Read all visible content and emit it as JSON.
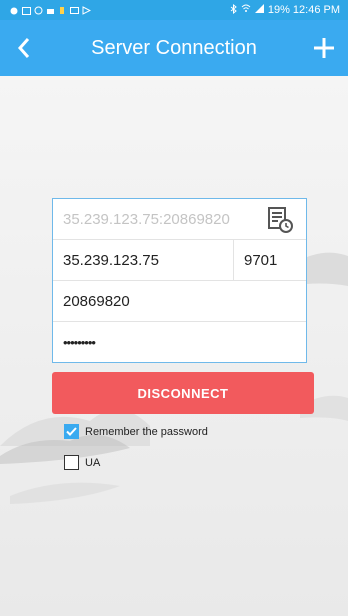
{
  "status_bar": {
    "right_text": "19% 12:46 PM",
    "icons": [
      "dot-icon",
      "gallery-icon",
      "at-icon",
      "android-icon",
      "battery-icon",
      "image-icon",
      "play-icon",
      "bluetooth-icon",
      "wifi-icon",
      "signal-icon",
      "battery-icon"
    ]
  },
  "app_bar": {
    "title": "Server Connection"
  },
  "form": {
    "address_placeholder": "35.239.123.75:20869820",
    "ip": "35.239.123.75",
    "port": "9701",
    "id": "20869820",
    "password": "•••••••••"
  },
  "disconnect_button": "DISCONNECT",
  "checkboxes": {
    "remember_label": "Remember the password",
    "remember_checked": true,
    "ua_label": "UA",
    "ua_checked": false
  },
  "colors": {
    "primary": "#3aaaf0",
    "danger": "#f25a5d",
    "field_border": "#6fb9ea"
  }
}
